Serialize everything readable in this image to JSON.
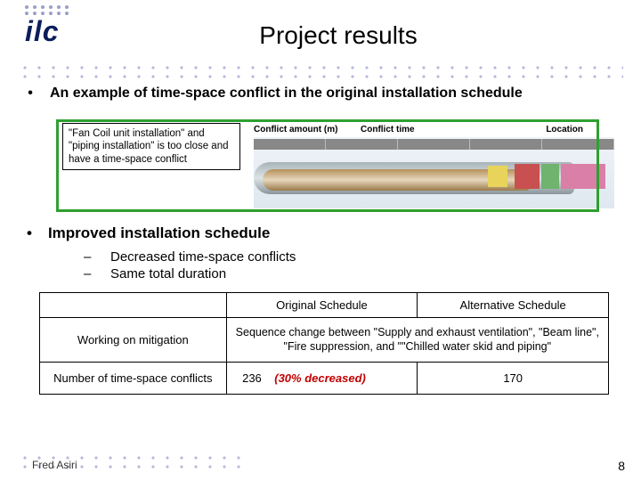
{
  "logo_text": "ilc",
  "title": "Project results",
  "bullets": {
    "example": "An example of time-space conflict in the original installation schedule",
    "improved": "Improved installation schedule"
  },
  "callout": "\"Fan Coil unit installation\" and \"piping installation\" is too close and have a time-space conflict",
  "diagram_labels": {
    "amount": "Conflict amount (m)",
    "time": "Conflict time",
    "location": "Location"
  },
  "subpoints": {
    "a": "Decreased time-space conflicts",
    "b": "Same total duration"
  },
  "table": {
    "headers": {
      "blank": "",
      "original": "Original Schedule",
      "alternative": "Alternative Schedule"
    },
    "rows": {
      "mitigation_label": "Working on mitigation",
      "mitigation_text": "Sequence change between \"Supply and exhaust ventilation\", \"Beam line\", \"Fire suppression, and \"\"Chilled water skid and piping\"",
      "conflicts_label": "Number of time-space conflicts",
      "conflicts_original": "236",
      "conflicts_decrease": "(30% decreased)",
      "conflicts_alternative": "170"
    }
  },
  "footer": {
    "author": "Fred Asiri",
    "page": "8"
  }
}
